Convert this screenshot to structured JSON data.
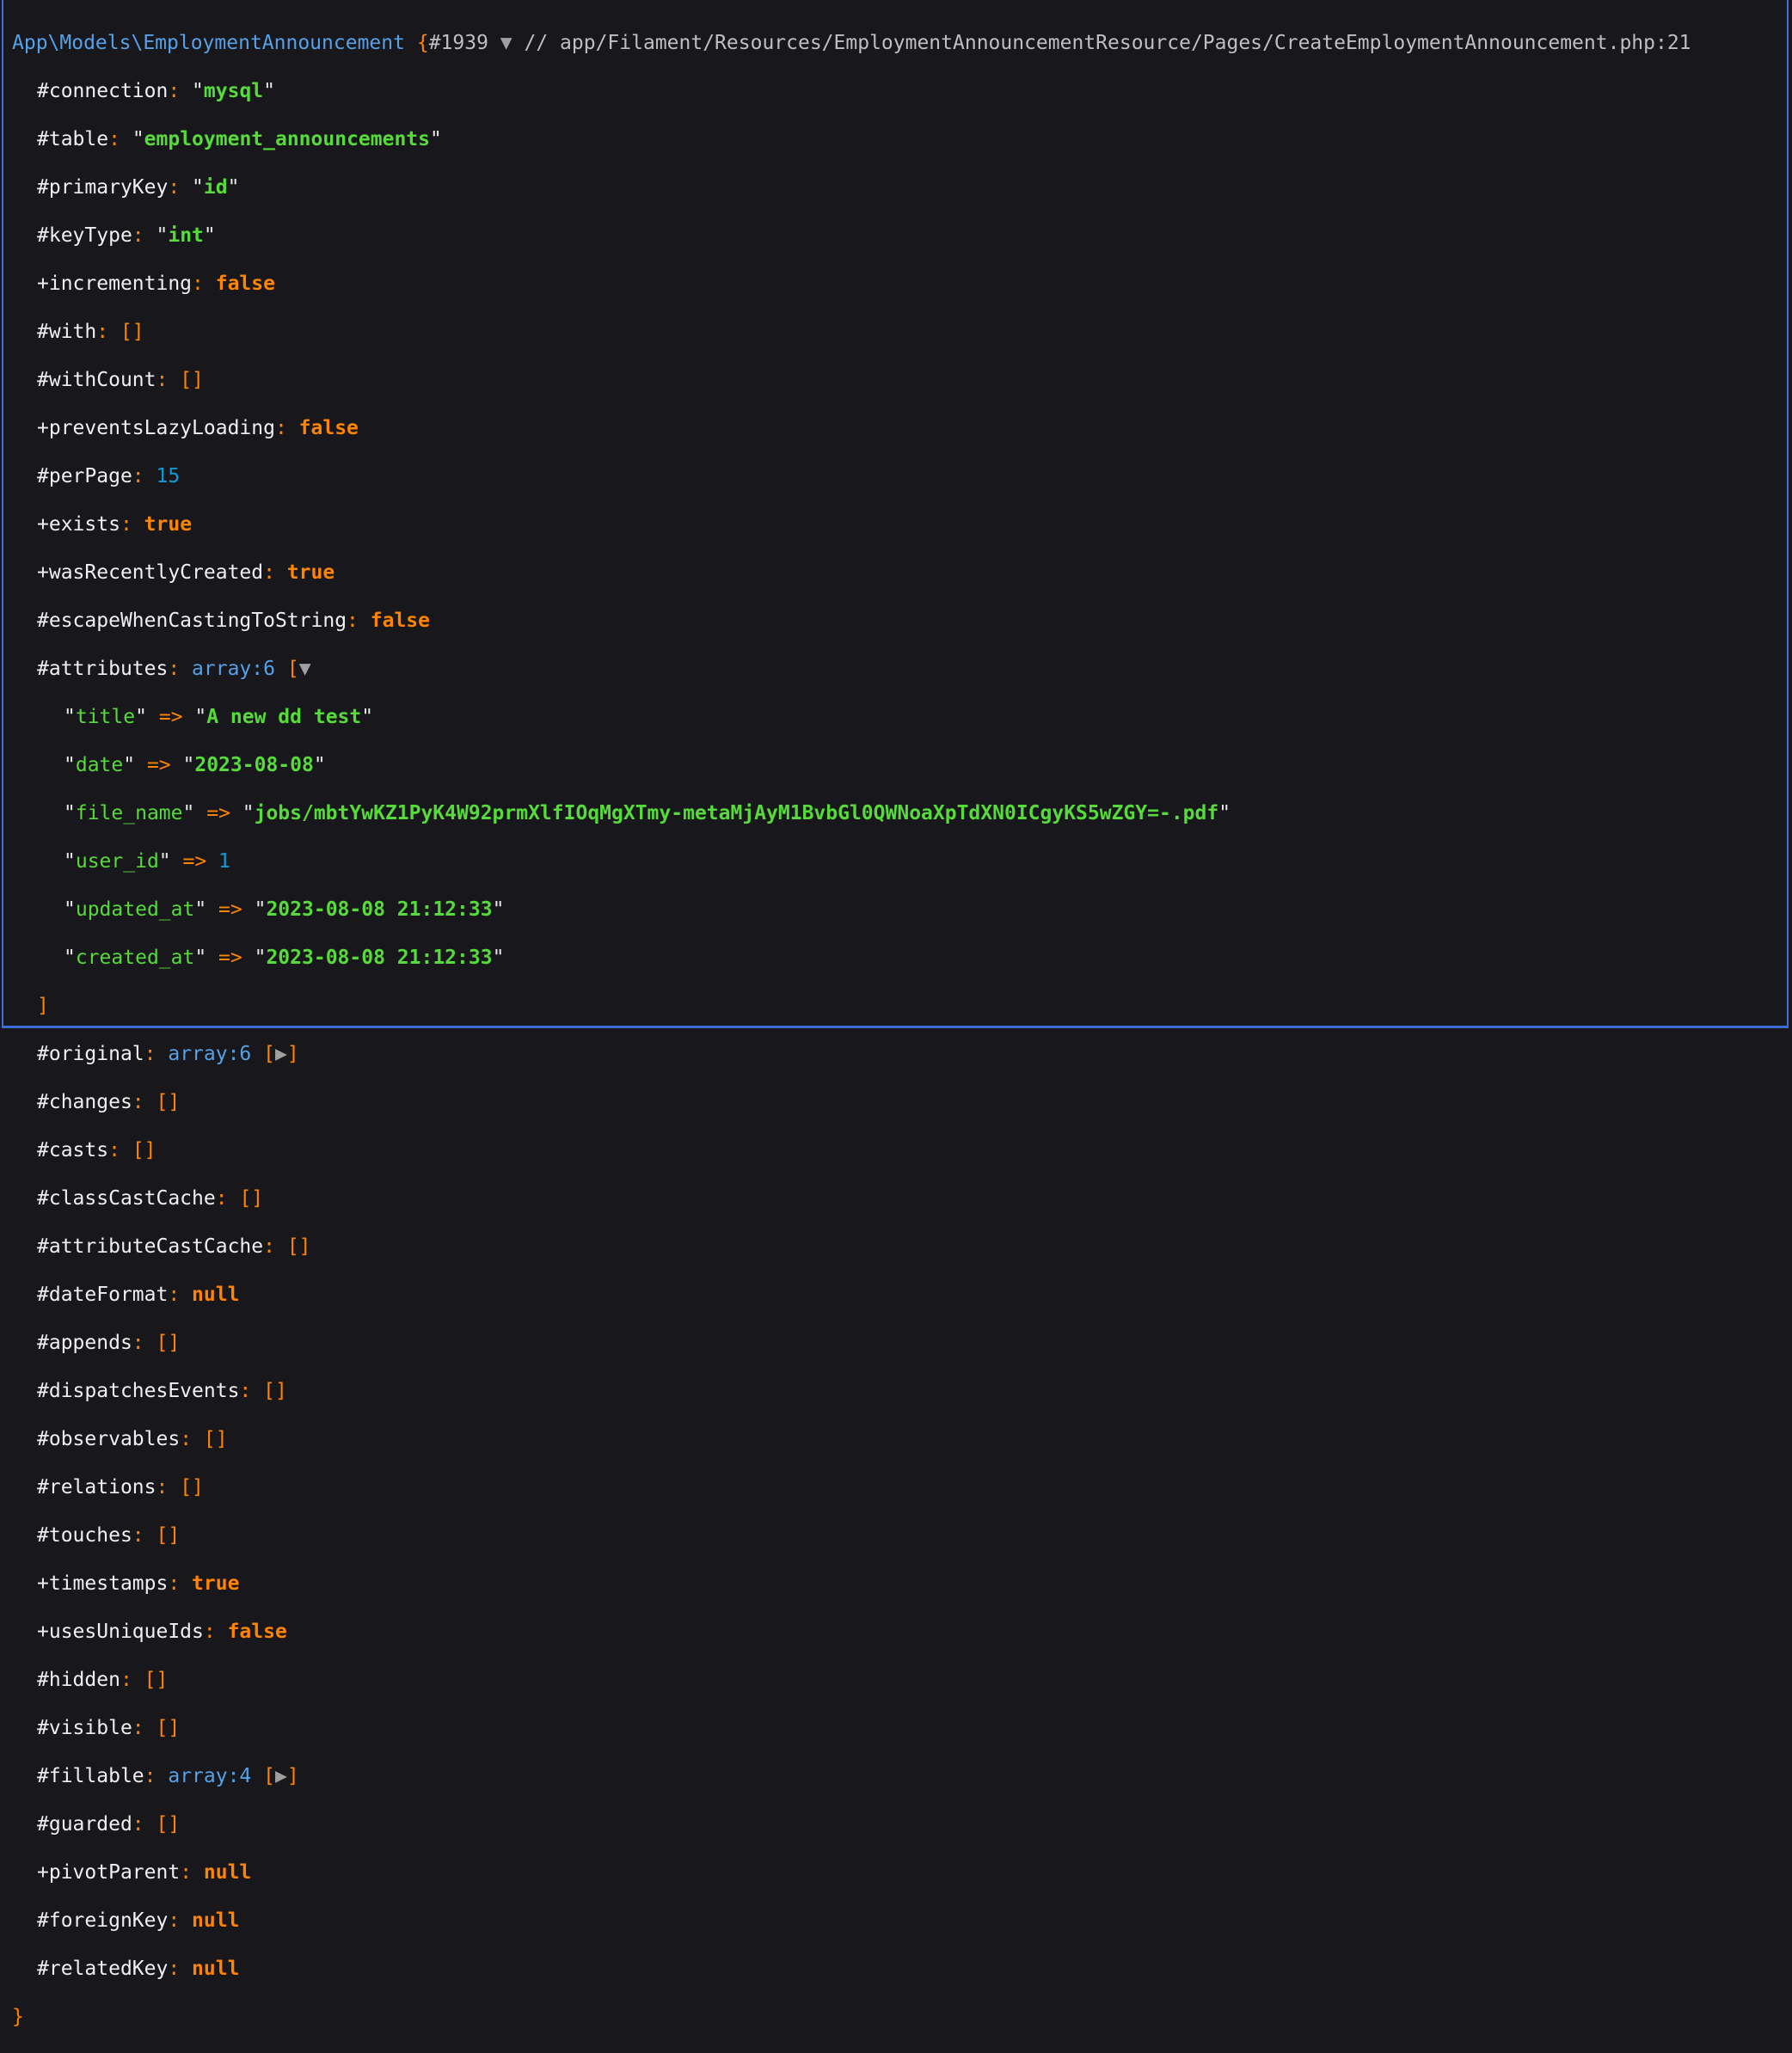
{
  "header": {
    "class_name": "App\\Models\\EmploymentAnnouncement",
    "open_brace": "{",
    "object_id": "#1939",
    "toggle": "▼",
    "comment": " // app/Filament/Resources/EmploymentAnnouncementResource/Pages/CreateEmploymentAnnouncement.php:21"
  },
  "props": {
    "connection": {
      "prefix": "#",
      "name": "connection",
      "value": "mysql"
    },
    "table": {
      "prefix": "#",
      "name": "table",
      "value": "employment_announcements"
    },
    "primaryKey": {
      "prefix": "#",
      "name": "primaryKey",
      "value": "id"
    },
    "keyType": {
      "prefix": "#",
      "name": "keyType",
      "value": "int"
    },
    "incrementing": {
      "prefix": "+",
      "name": "incrementing",
      "value": "false"
    },
    "with": {
      "prefix": "#",
      "name": "with",
      "value": "[]"
    },
    "withCount": {
      "prefix": "#",
      "name": "withCount",
      "value": "[]"
    },
    "preventsLazyLoading": {
      "prefix": "+",
      "name": "preventsLazyLoading",
      "value": "false"
    },
    "perPage": {
      "prefix": "#",
      "name": "perPage",
      "value": "15"
    },
    "exists": {
      "prefix": "+",
      "name": "exists",
      "value": "true"
    },
    "wasRecentlyCreated": {
      "prefix": "+",
      "name": "wasRecentlyCreated",
      "value": "true"
    },
    "escapeWhenCastingToString": {
      "prefix": "#",
      "name": "escapeWhenCastingToString",
      "value": "false"
    },
    "attributes": {
      "prefix": "#",
      "name": "attributes",
      "note": "array:6",
      "toggle": "▼"
    },
    "original": {
      "prefix": "#",
      "name": "original",
      "note": "array:6",
      "toggle": "▶"
    },
    "changes": {
      "prefix": "#",
      "name": "changes",
      "value": "[]"
    },
    "casts": {
      "prefix": "#",
      "name": "casts",
      "value": "[]"
    },
    "classCastCache": {
      "prefix": "#",
      "name": "classCastCache",
      "value": "[]"
    },
    "attributeCastCache": {
      "prefix": "#",
      "name": "attributeCastCache",
      "value": "[]"
    },
    "dateFormat": {
      "prefix": "#",
      "name": "dateFormat",
      "value": "null"
    },
    "appends": {
      "prefix": "#",
      "name": "appends",
      "value": "[]"
    },
    "dispatchesEvents": {
      "prefix": "#",
      "name": "dispatchesEvents",
      "value": "[]"
    },
    "observables": {
      "prefix": "#",
      "name": "observables",
      "value": "[]"
    },
    "relations": {
      "prefix": "#",
      "name": "relations",
      "value": "[]"
    },
    "touches": {
      "prefix": "#",
      "name": "touches",
      "value": "[]"
    },
    "timestamps": {
      "prefix": "+",
      "name": "timestamps",
      "value": "true"
    },
    "usesUniqueIds": {
      "prefix": "+",
      "name": "usesUniqueIds",
      "value": "false"
    },
    "hidden": {
      "prefix": "#",
      "name": "hidden",
      "value": "[]"
    },
    "visible": {
      "prefix": "#",
      "name": "visible",
      "value": "[]"
    },
    "fillable": {
      "prefix": "#",
      "name": "fillable",
      "note": "array:4",
      "toggle": "▶"
    },
    "guarded": {
      "prefix": "#",
      "name": "guarded",
      "value": "[]"
    },
    "pivotParent": {
      "prefix": "+",
      "name": "pivotParent",
      "value": "null"
    },
    "foreignKey": {
      "prefix": "#",
      "name": "foreignKey",
      "value": "null"
    },
    "relatedKey": {
      "prefix": "#",
      "name": "relatedKey",
      "value": "null"
    }
  },
  "attributes": {
    "title": {
      "key": "title",
      "value": "A new dd test"
    },
    "date": {
      "key": "date",
      "value": "2023-08-08"
    },
    "file_name": {
      "key": "file_name",
      "value": "jobs/mbtYwKZ1PyK4W92prmXlfIOqMgXTmy-metaMjAyM1BvbGl0QWNoaXpTdXN0ICgyKS5wZGY=-.pdf"
    },
    "user_id": {
      "key": "user_id",
      "value": "1"
    },
    "updated_at": {
      "key": "updated_at",
      "value": "2023-08-08 21:12:33"
    },
    "created_at": {
      "key": "created_at",
      "value": "2023-08-08 21:12:33"
    }
  },
  "syntax": {
    "colon": ": ",
    "quote": "\"",
    "arrow": " => ",
    "bracket_open": "[",
    "bracket_close": "]",
    "close_brace": "}"
  }
}
